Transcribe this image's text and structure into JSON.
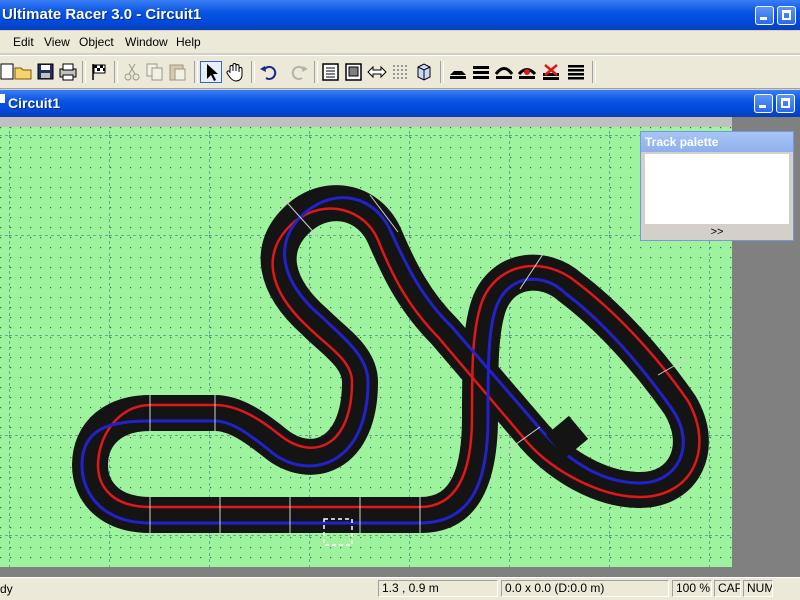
{
  "app": {
    "title": "Ultimate Racer 3.0 - Circuit1"
  },
  "menu": [
    "Edit",
    "View",
    "Object",
    "Window",
    "Help"
  ],
  "toolbar": [
    {
      "name": "new-icon"
    },
    {
      "name": "open-icon"
    },
    {
      "name": "save-icon"
    },
    {
      "name": "print-icon"
    },
    {
      "name": "race-flag-icon"
    },
    {
      "name": "cut-icon",
      "disabled": true
    },
    {
      "name": "copy-icon",
      "disabled": true
    },
    {
      "name": "paste-icon",
      "disabled": true
    },
    {
      "name": "select-pointer-icon",
      "active": true
    },
    {
      "name": "pan-hand-icon"
    },
    {
      "name": "undo-icon"
    },
    {
      "name": "redo-icon",
      "disabled": true
    },
    {
      "name": "view-track-icon"
    },
    {
      "name": "view-layout-icon"
    },
    {
      "name": "resize-icon"
    },
    {
      "name": "grid-icon"
    },
    {
      "name": "3d-icon"
    },
    {
      "name": "section-straight-icon"
    },
    {
      "name": "section-double-icon"
    },
    {
      "name": "section-curve-icon"
    },
    {
      "name": "section-crossing-icon"
    },
    {
      "name": "section-delete-icon"
    },
    {
      "name": "section-multi-icon"
    }
  ],
  "document": {
    "title": "Circuit1"
  },
  "palette": {
    "title": "Track palette",
    "more": ">>"
  },
  "status": {
    "left": "dy",
    "coords": "1.3 , 0.9 m",
    "size": "0.0 x 0.0  (D:0.0 m)",
    "zoom": "100 %",
    "caps": "CAP",
    "num": "NUM"
  },
  "colors": {
    "canvas": "#9ef49e",
    "track": "#1a1a1a",
    "lane_red": "#e01818",
    "lane_blue": "#2222cc",
    "title_bar": "#0a55e3"
  }
}
